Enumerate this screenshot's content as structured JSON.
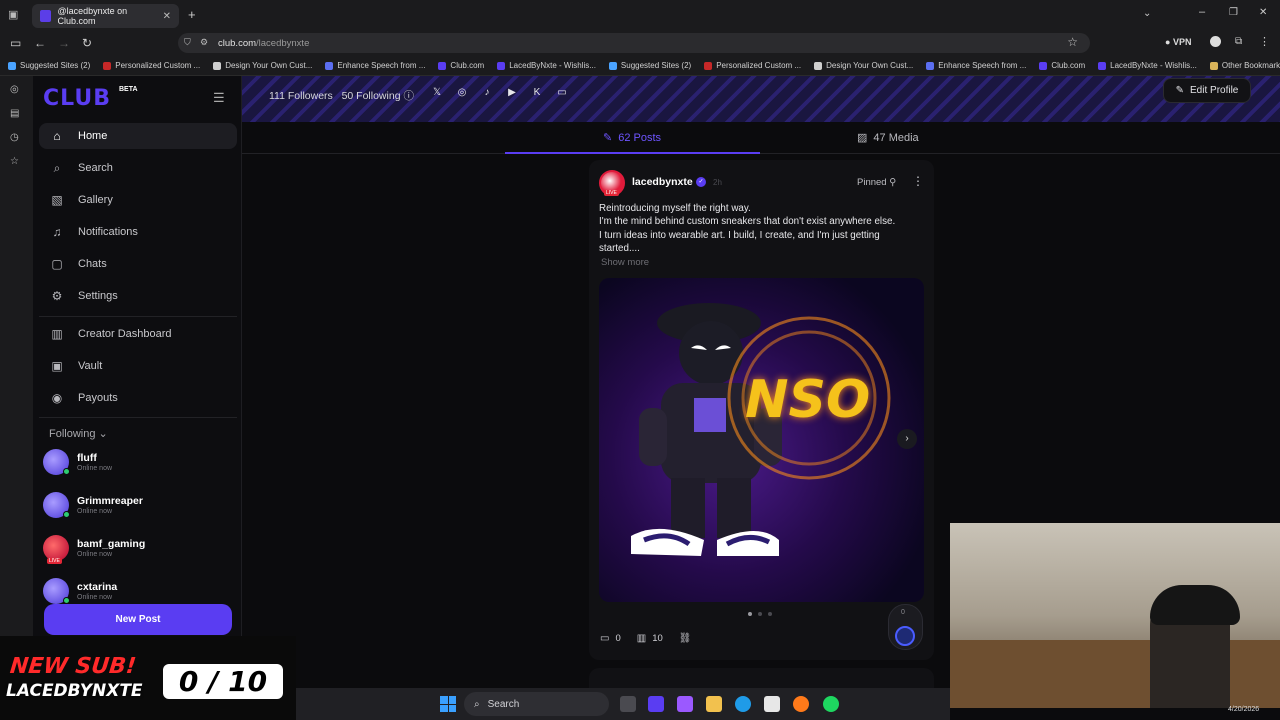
{
  "browser": {
    "tab_title": "@lacedbynxte on Club.com",
    "url_domain": "club.com",
    "url_path": "/lacedbynxte",
    "vpn_label": "VPN",
    "bookmarks": [
      {
        "label": "Suggested Sites (2)",
        "color": "#4aa3ff"
      },
      {
        "label": "Personalized Custom ...",
        "color": "#c62828"
      },
      {
        "label": "Design Your Own Cust...",
        "color": "#cfcfcf"
      },
      {
        "label": "Enhance Speech from ...",
        "color": "#5b6ef0"
      },
      {
        "label": "Club.com",
        "color": "#5a3df2"
      },
      {
        "label": "LacedByNxte - Wishlis...",
        "color": "#5a3df2"
      },
      {
        "label": "Suggested Sites (2)",
        "color": "#4aa3ff"
      },
      {
        "label": "Personalized Custom ...",
        "color": "#c62828"
      },
      {
        "label": "Design Your Own Cust...",
        "color": "#cfcfcf"
      },
      {
        "label": "Enhance Speech from ...",
        "color": "#5b6ef0"
      },
      {
        "label": "Club.com",
        "color": "#5a3df2"
      },
      {
        "label": "LacedByNxte - Wishlis...",
        "color": "#5a3df2"
      }
    ],
    "other_bookmarks": "Other Bookmarks"
  },
  "sidebar": {
    "logo": "CLUB",
    "beta": "BETA",
    "nav": [
      {
        "label": "Home",
        "icon": "home-icon"
      },
      {
        "label": "Search",
        "icon": "search-icon"
      },
      {
        "label": "Gallery",
        "icon": "gallery-icon"
      },
      {
        "label": "Notifications",
        "icon": "bell-icon"
      },
      {
        "label": "Chats",
        "icon": "chat-icon"
      },
      {
        "label": "Settings",
        "icon": "gear-icon"
      },
      {
        "label": "Creator Dashboard",
        "icon": "dashboard-icon"
      },
      {
        "label": "Vault",
        "icon": "vault-icon"
      },
      {
        "label": "Payouts",
        "icon": "payouts-icon"
      }
    ],
    "following_header": "Following",
    "following": [
      {
        "name": "fluff",
        "status": "Online now"
      },
      {
        "name": "Grimmreaper",
        "status": "Online now"
      },
      {
        "name": "bamf_gaming",
        "status": "Online now"
      },
      {
        "name": "cxtarina",
        "status": "Online now"
      }
    ],
    "new_post": "New Post"
  },
  "profile": {
    "followers": "111 Followers",
    "following": "50 Following",
    "edit_profile": "Edit Profile",
    "tabs": [
      {
        "label": "62 Posts"
      },
      {
        "label": "47 Media"
      }
    ]
  },
  "post": {
    "username": "lacedbynxte",
    "time": "2h",
    "pinned": "Pinned",
    "text_lines": [
      "Reintroducing myself the right way.",
      "I'm the mind behind custom sneakers that don't exist anywhere else.",
      "I turn ideas into wearable art. I build, I create, and I'm just getting",
      "started...."
    ],
    "show_more": "Show more",
    "image_text": "NSO",
    "comments": "0",
    "views": "10",
    "boost_count": "0"
  },
  "overlay": {
    "new_sub": "NEW SUB!",
    "sub_name": "LACEDBYNXTE",
    "counter": "0 / 10"
  },
  "taskbar": {
    "search": "Search",
    "date": "4/20/2026"
  },
  "colors": {
    "accent": "#5a3df2",
    "live": "#e32636",
    "online": "#2ecc71"
  }
}
